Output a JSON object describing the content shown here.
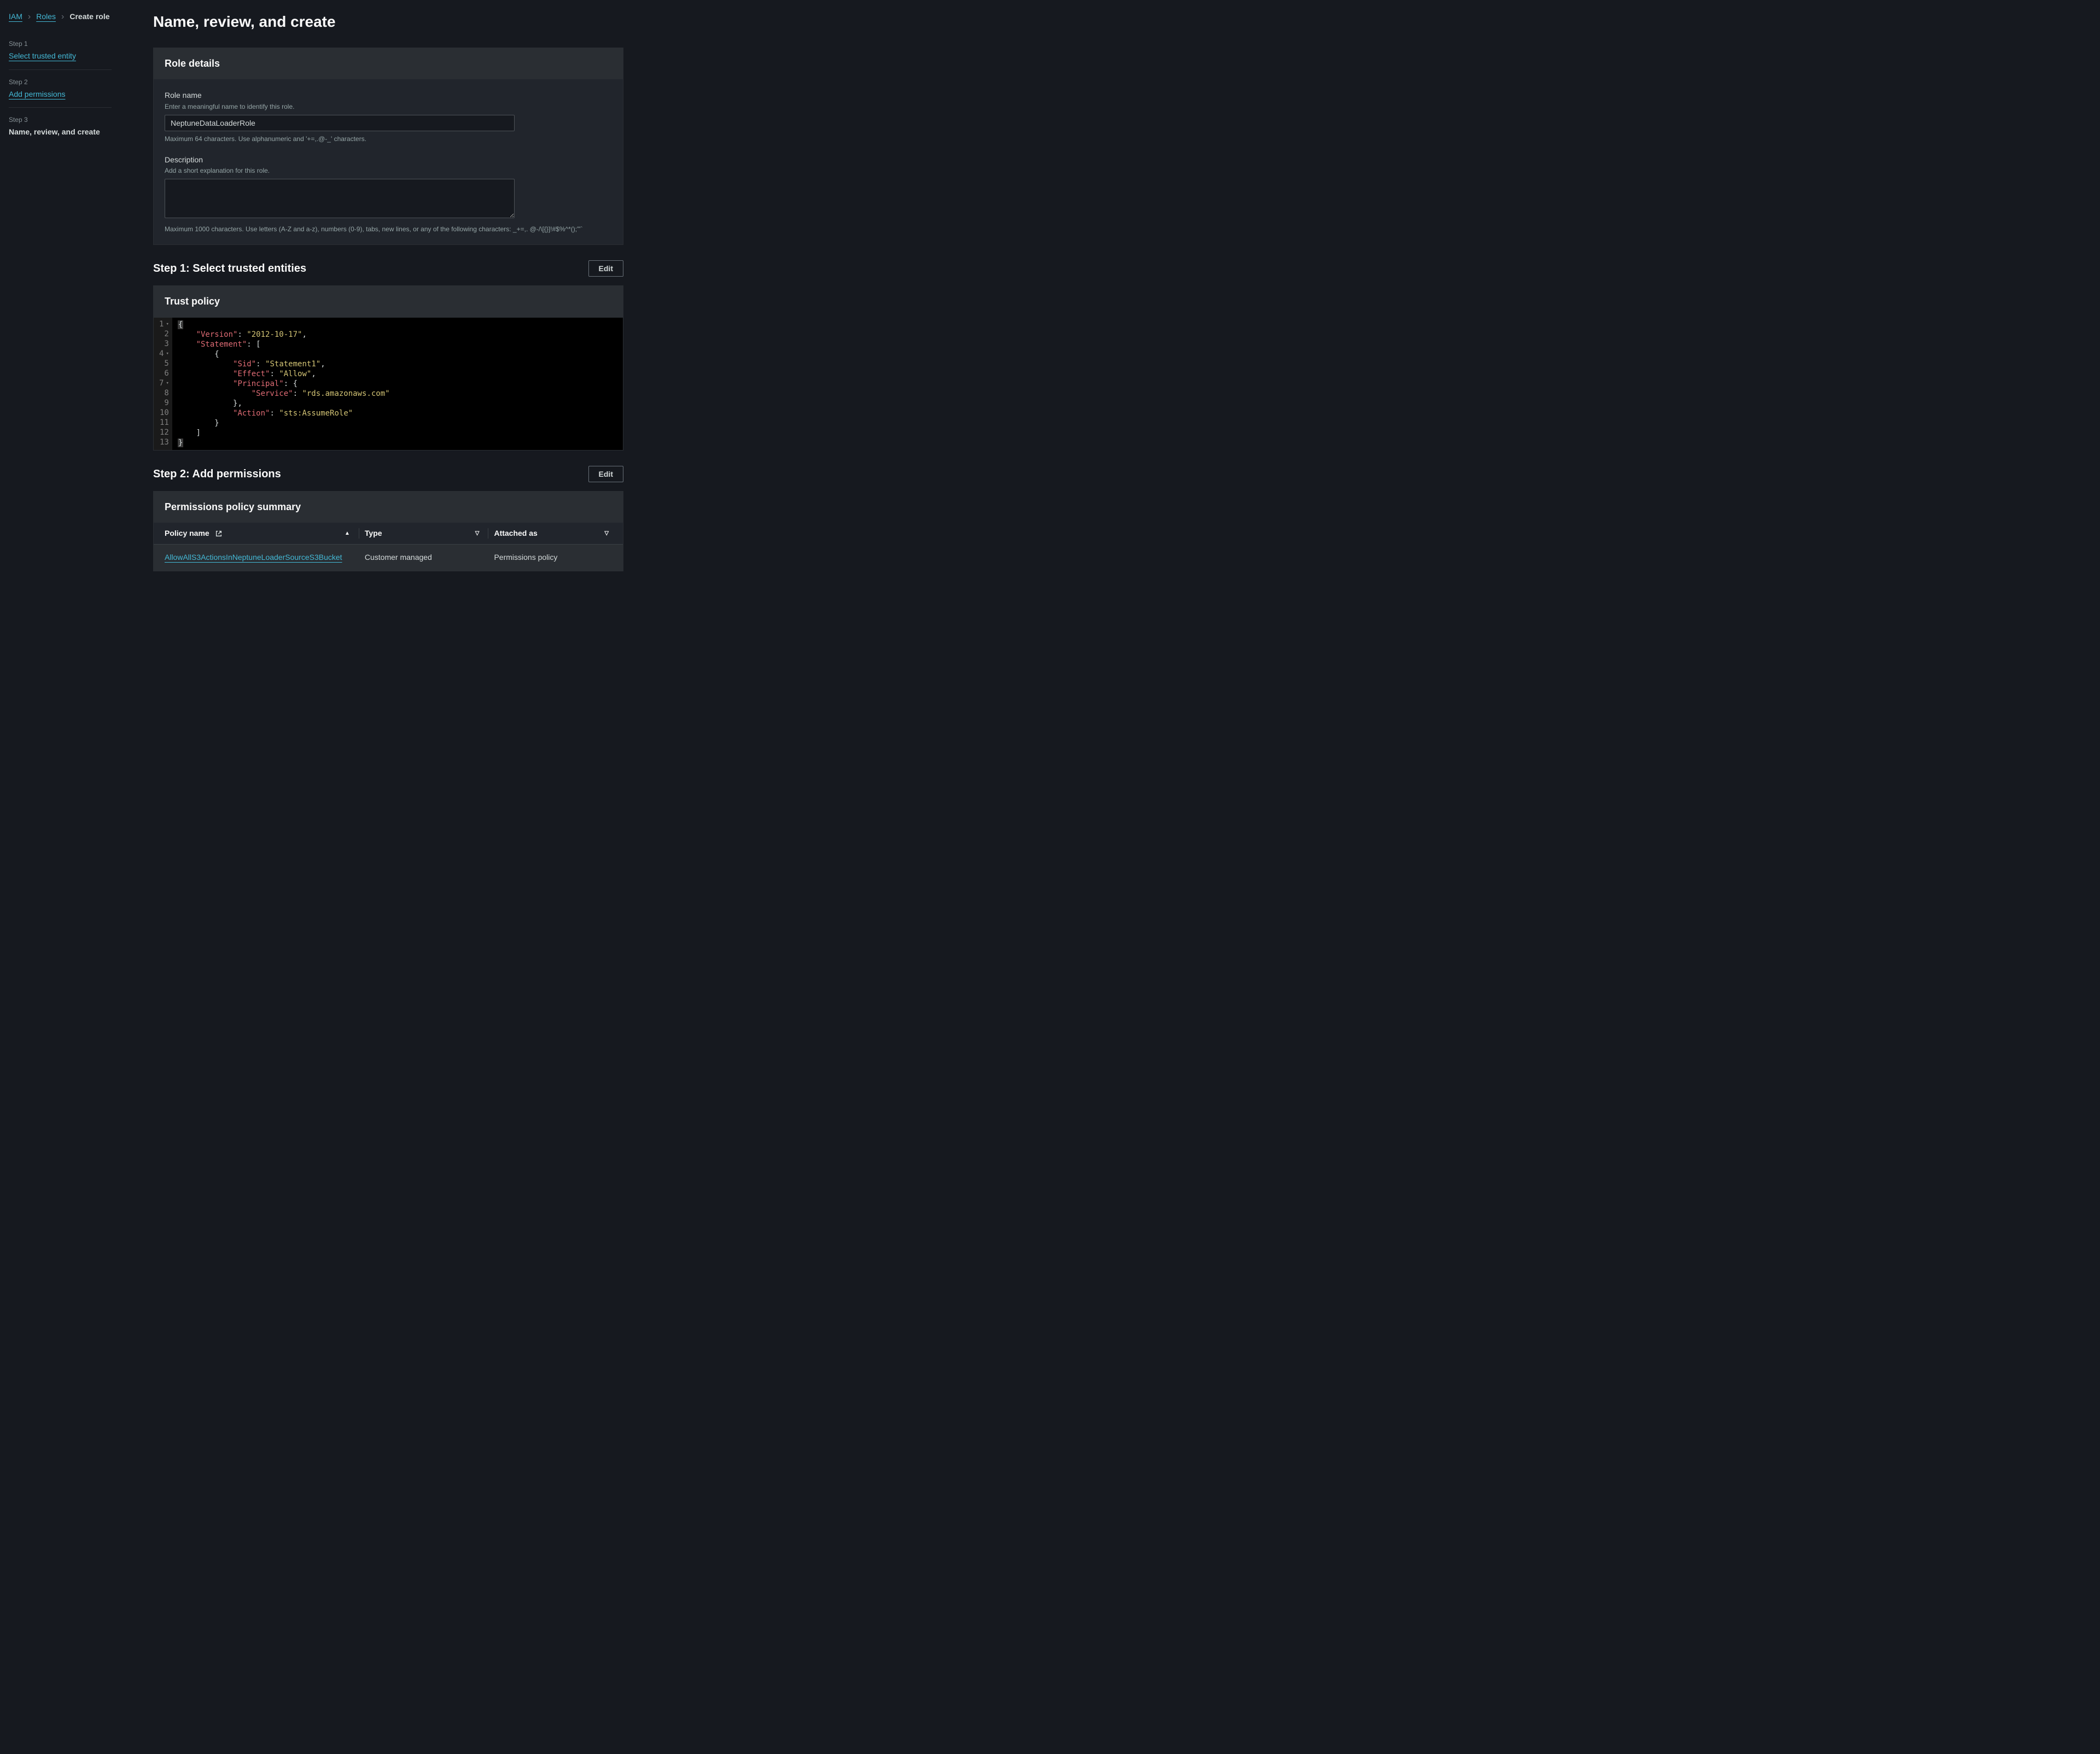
{
  "breadcrumb": {
    "iam": "IAM",
    "roles": "Roles",
    "current": "Create role"
  },
  "sidebar": {
    "step1_label": "Step 1",
    "step1_link": "Select trusted entity",
    "step2_label": "Step 2",
    "step2_link": "Add permissions",
    "step3_label": "Step 3",
    "step3_current": "Name, review, and create"
  },
  "page_title": "Name, review, and create",
  "role_details": {
    "heading": "Role details",
    "name_label": "Role name",
    "name_hint": "Enter a meaningful name to identify this role.",
    "name_value": "NeptuneDataLoaderRole",
    "name_footnote": "Maximum 64 characters. Use alphanumeric and '+=,.@-_' characters.",
    "desc_label": "Description",
    "desc_hint": "Add a short explanation for this role.",
    "desc_value": "",
    "desc_footnote": "Maximum 1000 characters. Use letters (A-Z and a-z), numbers (0-9), tabs, new lines, or any of the following characters: _+=,. @-/\\[{}]!#$%^*();'\"`"
  },
  "step1_review": {
    "heading": "Step 1: Select trusted entities",
    "edit": "Edit",
    "panel_title": "Trust policy",
    "policy": {
      "Version": "2012-10-17",
      "Statement": [
        {
          "Sid": "Statement1",
          "Effect": "Allow",
          "Principal": {
            "Service": "rds.amazonaws.com"
          },
          "Action": "sts:AssumeRole"
        }
      ]
    },
    "line_numbers": [
      "1",
      "2",
      "3",
      "4",
      "5",
      "6",
      "7",
      "8",
      "9",
      "10",
      "11",
      "12",
      "13"
    ]
  },
  "step2_review": {
    "heading": "Step 2: Add permissions",
    "edit": "Edit",
    "panel_title": "Permissions policy summary",
    "columns": {
      "name": "Policy name",
      "type": "Type",
      "attached": "Attached as"
    },
    "rows": [
      {
        "name": "AllowAllS3ActionsInNeptuneLoaderSourceS3Bucket",
        "type": "Customer managed",
        "attached": "Permissions policy"
      }
    ]
  }
}
